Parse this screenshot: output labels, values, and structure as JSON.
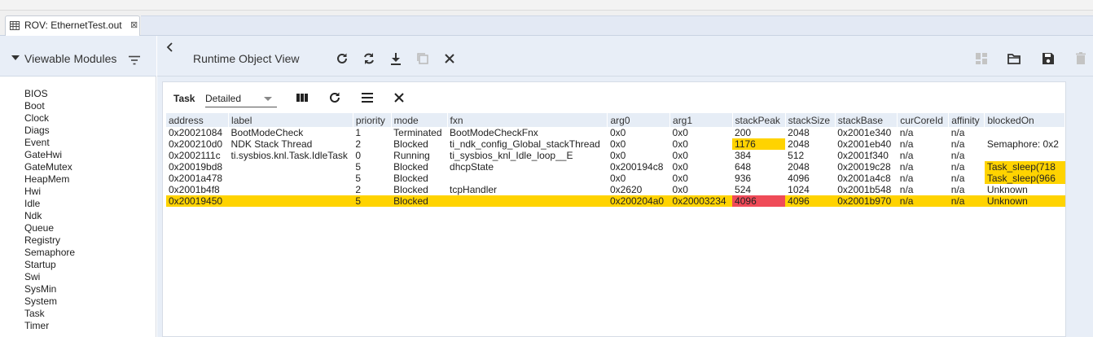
{
  "editor_tab": {
    "label": "ROV: EthernetTest.out",
    "close_glyph": "⊠"
  },
  "left_panel": {
    "title": "Viewable Modules",
    "modules": [
      "BIOS",
      "Boot",
      "Clock",
      "Diags",
      "Event",
      "GateHwi",
      "GateMutex",
      "HeapMem",
      "Hwi",
      "Idle",
      "Ndk",
      "Queue",
      "Registry",
      "Semaphore",
      "Startup",
      "Swi",
      "SysMin",
      "System",
      "Task",
      "Timer"
    ]
  },
  "main": {
    "title": "Runtime Object View",
    "toolbar_icons": [
      "refresh-icon",
      "continuous-refresh-icon",
      "download-icon",
      "clone-icon",
      "close-icon"
    ],
    "right_icons": [
      "dashboard-icon",
      "folder-open-icon",
      "save-icon",
      "delete-icon"
    ]
  },
  "task_view": {
    "module_label": "Task",
    "view_mode": "Detailed",
    "columns": [
      "address",
      "label",
      "priority",
      "mode",
      "fxn",
      "arg0",
      "arg1",
      "stackPeak",
      "stackSize",
      "stackBase",
      "curCoreId",
      "affinity",
      "blockedOn"
    ],
    "rows": [
      [
        "0x20021084",
        "BootModeCheck",
        "1",
        "Terminated",
        "BootModeCheckFnx",
        "0x0",
        "0x0",
        "200",
        "2048",
        "0x2001e340",
        "n/a",
        "n/a",
        ""
      ],
      [
        "0x200210d0",
        "NDK Stack Thread",
        "2",
        "Blocked",
        "ti_ndk_config_Global_stackThread",
        "0x0",
        "0x0",
        "1176",
        "2048",
        "0x2001eb40",
        "n/a",
        "n/a",
        "Semaphore: 0x2"
      ],
      [
        "0x2002111c",
        "ti.sysbios.knl.Task.IdleTask",
        "0",
        "Running",
        "ti_sysbios_knl_Idle_loop__E",
        "0x0",
        "0x0",
        "384",
        "512",
        "0x2001f340",
        "n/a",
        "n/a",
        ""
      ],
      [
        "0x20019bd8",
        "",
        "5",
        "Blocked",
        "dhcpState",
        "0x200194c8",
        "0x0",
        "648",
        "2048",
        "0x20019c28",
        "n/a",
        "n/a",
        "Task_sleep(718"
      ],
      [
        "0x2001a478",
        "",
        "5",
        "Blocked",
        "",
        "0x0",
        "0x0",
        "936",
        "4096",
        "0x2001a4c8",
        "n/a",
        "n/a",
        "Task_sleep(966"
      ],
      [
        "0x2001b4f8",
        "",
        "2",
        "Blocked",
        "tcpHandler",
        "0x2620",
        "0x0",
        "524",
        "1024",
        "0x2001b548",
        "n/a",
        "n/a",
        "Unknown"
      ],
      [
        "0x20019450",
        "",
        "5",
        "Blocked",
        "",
        "0x200204a0",
        "0x20003234",
        "4096",
        "4096",
        "0x2001b970",
        "n/a",
        "n/a",
        "Unknown"
      ]
    ],
    "highlighted_row": 6,
    "highlighted_cells": [
      {
        "row": 1,
        "col": 7,
        "color": "#ffd300"
      },
      {
        "row": 3,
        "col": 12,
        "color": "#ffd300"
      },
      {
        "row": 4,
        "col": 12,
        "color": "#ffd300"
      },
      {
        "row": 6,
        "col": 7,
        "color": "#ef4b58"
      }
    ],
    "colors": {
      "warning": "#ffd300",
      "error": "#ef4b58",
      "header_bg": "#e6edf6"
    }
  }
}
